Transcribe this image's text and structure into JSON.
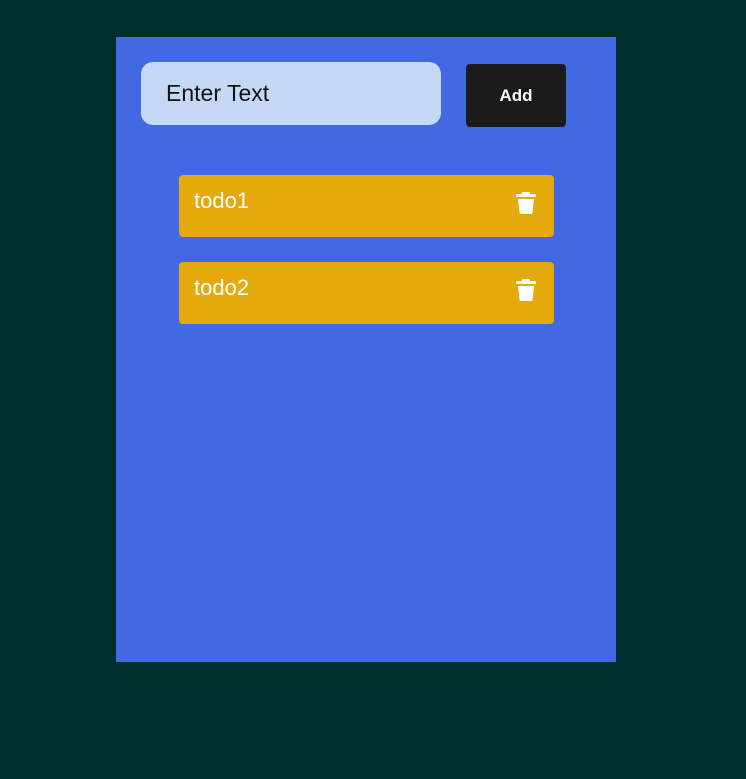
{
  "colors": {
    "page_background": "#022e30",
    "panel_background": "#4169e1",
    "input_background": "#c5d8f5",
    "button_background": "#1b1b1b",
    "todo_background": "#e5a90a",
    "todo_text": "#ffffff"
  },
  "input": {
    "value": "",
    "placeholder": "Enter Text"
  },
  "add_button": {
    "label": "Add"
  },
  "todos": [
    {
      "label": "todo1",
      "icon": "trash-icon"
    },
    {
      "label": "todo2",
      "icon": "trash-icon"
    }
  ]
}
